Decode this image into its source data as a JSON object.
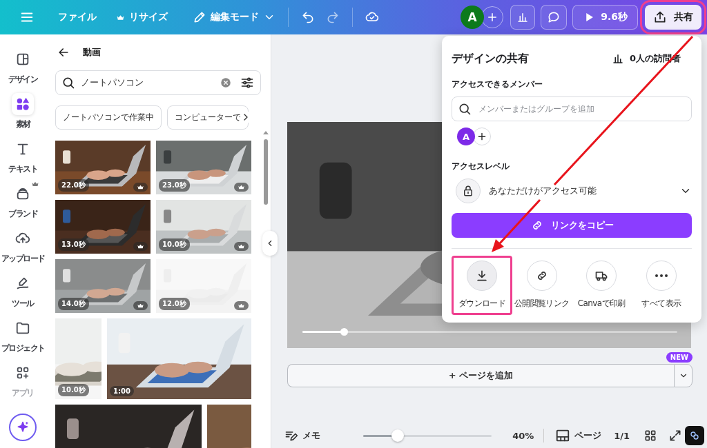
{
  "top_bar": {
    "file_menu": "ファイル",
    "resize": "リサイズ",
    "edit_mode": "編集モード",
    "avatar": "A",
    "play_time": "9.6秒",
    "share": {
      "label": "共有",
      "highlighted": true
    }
  },
  "rail": [
    {
      "label": "デザイン",
      "selected": false,
      "premium": false,
      "disabled": false
    },
    {
      "label": "素材",
      "selected": true,
      "premium": false,
      "disabled": false
    },
    {
      "label": "テキスト",
      "selected": false,
      "premium": false,
      "disabled": false
    },
    {
      "label": "ブランド",
      "selected": false,
      "premium": true,
      "disabled": false
    },
    {
      "label": "アップロード",
      "selected": false,
      "premium": false,
      "disabled": false
    },
    {
      "label": "ツール",
      "selected": false,
      "premium": false,
      "disabled": false
    },
    {
      "label": "プロジェクト",
      "selected": false,
      "premium": false,
      "disabled": false
    },
    {
      "label": "アプリ",
      "selected": false,
      "premium": false,
      "disabled": true
    }
  ],
  "panel": {
    "title": "動画",
    "search": {
      "value": "ノートパソコン"
    },
    "chips": [
      "ノートパソコンで作業中",
      "コンピューターで"
    ],
    "videos": [
      [
        {
          "kind": "video",
          "duration": "22.0秒",
          "premium": true
        },
        {
          "kind": "video",
          "duration": "23.0秒",
          "premium": true
        }
      ],
      [
        {
          "kind": "video",
          "duration": "13.0秒",
          "premium": true
        },
        {
          "kind": "video",
          "duration": "10.0秒",
          "premium": true
        }
      ],
      [
        {
          "kind": "video",
          "duration": "14.0秒",
          "premium": true
        },
        {
          "kind": "video",
          "duration": "12.0秒",
          "premium": true
        }
      ],
      [
        {
          "kind": "video",
          "duration": "10.0秒",
          "premium": false
        },
        {
          "kind": "video",
          "duration": "1:00",
          "premium": false
        }
      ],
      [
        {
          "kind": "picture"
        },
        {
          "kind": "picture"
        }
      ]
    ]
  },
  "canvas": {
    "video": {
      "level": 0.11
    },
    "add_page": "+ ページを追加",
    "new_badge": "NEW"
  },
  "share_panel": {
    "title": "デザインの共有",
    "visitors": "0人の訪問者",
    "members_label": "アクセスできるメンバー",
    "member_search": {
      "placeholder": "メンバーまたはグループを追加"
    },
    "member_avatar": "A",
    "access_label": "アクセスレベル",
    "access_value": "あなただけがアクセス可能",
    "copy_link": "リンクをコピー",
    "actions": [
      {
        "label": "ダウンロード",
        "highlighted": true
      },
      {
        "label": "公開閲覧リンク",
        "highlighted": false
      },
      {
        "label": "Canvaで印刷",
        "highlighted": false
      },
      {
        "label": "すべて表示",
        "highlighted": false
      }
    ]
  },
  "bottom_bar": {
    "notes": "メモ",
    "zoom": {
      "level": 0.27,
      "reading": "40%"
    },
    "pages": "ページ",
    "page_count": "1/1"
  }
}
